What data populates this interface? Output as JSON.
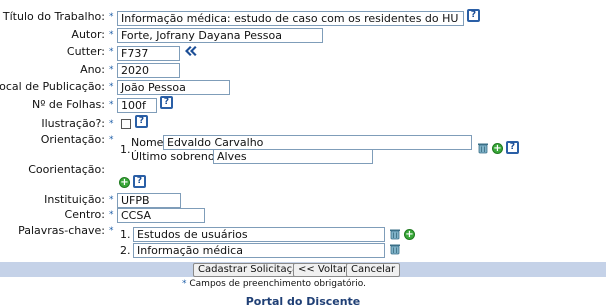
{
  "form": {
    "titulo_label": "Título do Trabalho:",
    "titulo_value": "Informação médica: estudo de caso com os residentes do HU",
    "autor_label": "Autor:",
    "autor_value": "Forte, Jofrany Dayana Pessoa",
    "cutter_label": "Cutter:",
    "cutter_value": "F737",
    "ano_label": "Ano:",
    "ano_value": "2020",
    "local_label": "Local de Publicação:",
    "local_value": "João Pessoa",
    "folhas_label": "Nº de Folhas:",
    "folhas_value": "100f",
    "ilustracao_label": "Ilustração?:",
    "ilustracao_checked": false,
    "orientacao_label": "Orientação:",
    "orientacao_index": "1.",
    "nome_label": "Nome:",
    "nome_value": "Edvaldo Carvalho",
    "sobrenome_label": "Último sobrenome:",
    "sobrenome_value": "Alves",
    "coorientacao_label": "Coorientação:",
    "instituicao_label": "Instituição:",
    "instituicao_value": "UFPB",
    "centro_label": "Centro:",
    "centro_value": "CCSA",
    "palavras_label": "Palavras-chave:",
    "palavras": [
      {
        "index": "1.",
        "value": "Estudos de usuários"
      },
      {
        "index": "2.",
        "value": "Informação médica"
      }
    ],
    "required_star": "*"
  },
  "actions": {
    "cadastrar_label": "Cadastrar Solicitação",
    "voltar_label": "<< Voltar",
    "cancelar_label": "Cancelar"
  },
  "footer": {
    "required_note": "Campos de preenchimento obrigatório.",
    "portal_title": "Portal do Discente"
  },
  "icons": {
    "help": "help-icon",
    "add": "add-icon",
    "remove": "trash-icon",
    "back": "double-chevron-left-icon"
  },
  "colors": {
    "bar": "#c5d2e8",
    "accent": "#1f5fa8",
    "portal": "#1f3f75"
  }
}
